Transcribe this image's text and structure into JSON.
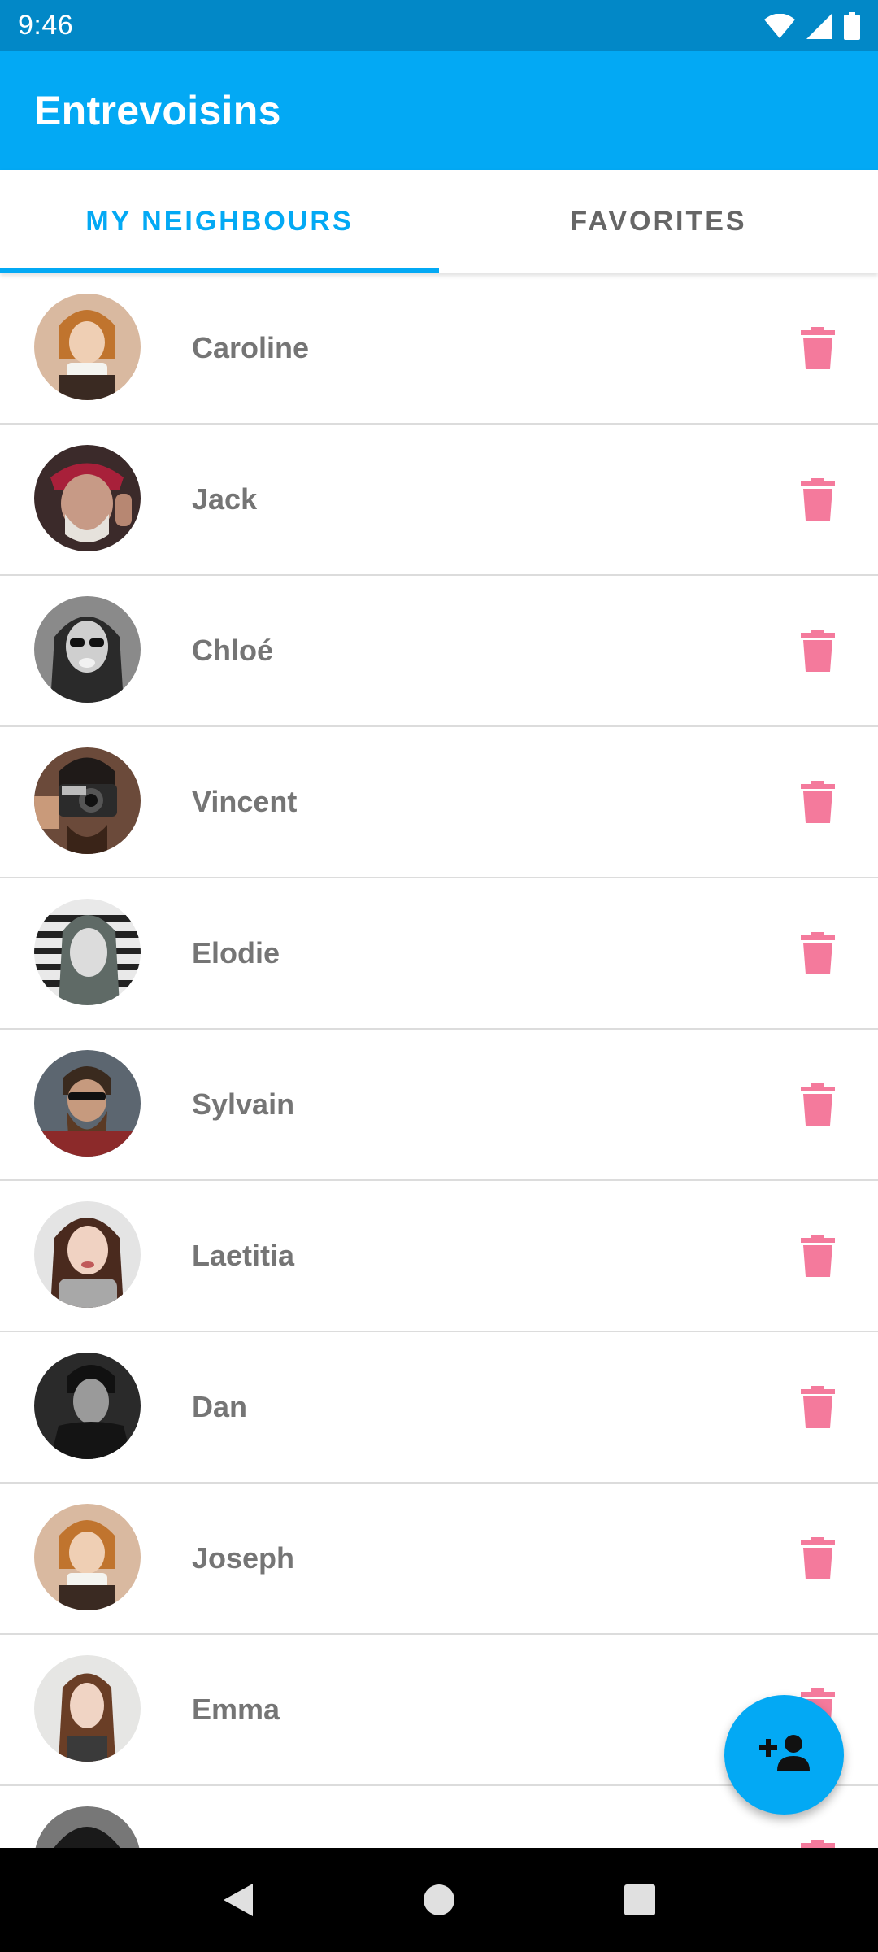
{
  "status_bar": {
    "time": "9:46",
    "icons": [
      "wifi-icon",
      "signal-icon",
      "battery-icon"
    ]
  },
  "app_bar": {
    "title": "Entrevoisins"
  },
  "tabs": [
    {
      "label": "MY NEIGHBOURS",
      "active": true
    },
    {
      "label": "FAVORITES",
      "active": false
    }
  ],
  "neighbours": [
    {
      "name": "Caroline",
      "avatar": "photo-caroline"
    },
    {
      "name": "Jack",
      "avatar": "photo-jack"
    },
    {
      "name": "Chloé",
      "avatar": "photo-chloe"
    },
    {
      "name": "Vincent",
      "avatar": "photo-vincent"
    },
    {
      "name": "Elodie",
      "avatar": "photo-elodie"
    },
    {
      "name": "Sylvain",
      "avatar": "photo-sylvain"
    },
    {
      "name": "Laetitia",
      "avatar": "photo-laetitia"
    },
    {
      "name": "Dan",
      "avatar": "photo-dan"
    },
    {
      "name": "Joseph",
      "avatar": "photo-joseph"
    },
    {
      "name": "Emma",
      "avatar": "photo-emma"
    },
    {
      "name": "",
      "avatar": "photo-partial"
    }
  ],
  "fab": {
    "icon": "add-person-icon"
  },
  "nav_bar": {
    "icons": [
      "back-icon",
      "home-icon",
      "recents-icon"
    ]
  },
  "colors": {
    "primary": "#03a9f4",
    "primary_dark": "#0288c7",
    "delete": "#f47a9c",
    "name_text": "#757575"
  }
}
